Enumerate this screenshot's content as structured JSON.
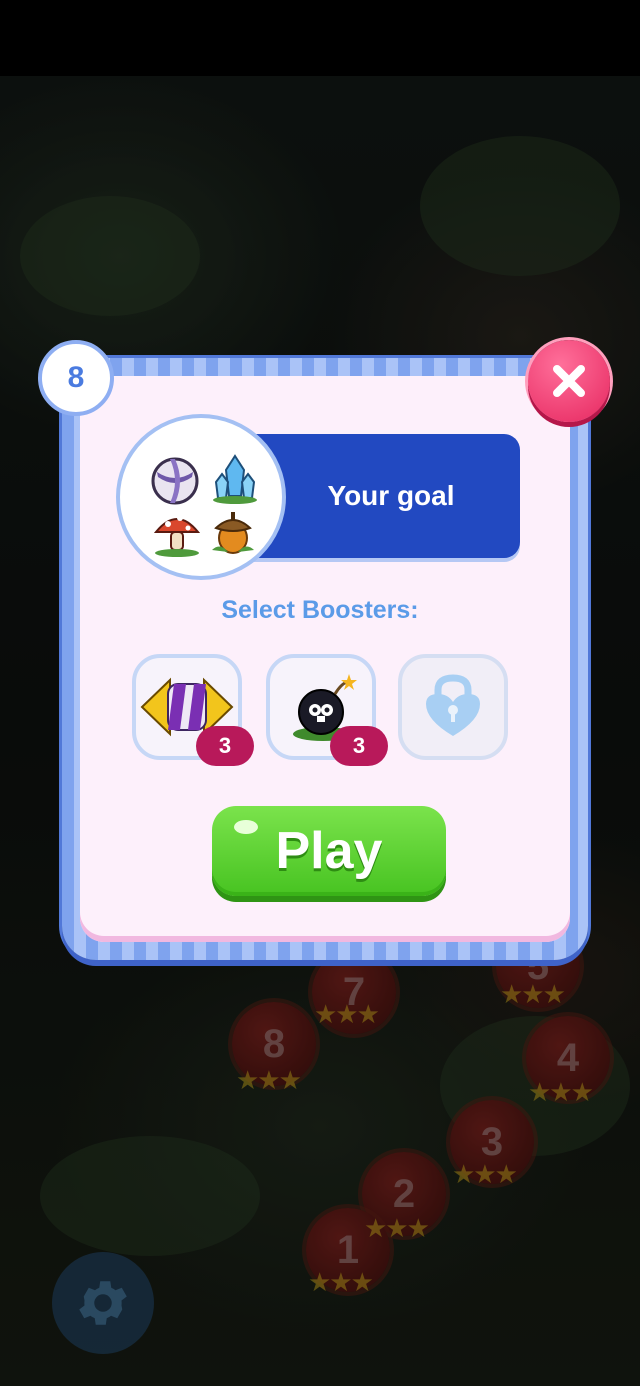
{
  "level": {
    "number": "8"
  },
  "goal": {
    "title": "Your goal",
    "items": [
      "beach-ball-icon",
      "crystal-icon",
      "mushroom-icon",
      "acorn-icon"
    ]
  },
  "boosters": {
    "label": "Select Boosters:",
    "items": [
      {
        "icon": "striped-candy-icon",
        "count": "3",
        "locked": false
      },
      {
        "icon": "bomb-icon",
        "count": "3",
        "locked": false
      },
      {
        "icon": "lock-icon",
        "locked": true
      }
    ]
  },
  "play": {
    "label": "Play"
  },
  "map": {
    "nodes": [
      "7",
      "5",
      "8",
      "4",
      "3",
      "2",
      "1"
    ]
  },
  "colors": {
    "frame": "#7fa3ee",
    "goal_banner": "#2249c1",
    "play": "#47c321",
    "close": "#e6275f",
    "count_badge": "#b8195a"
  }
}
